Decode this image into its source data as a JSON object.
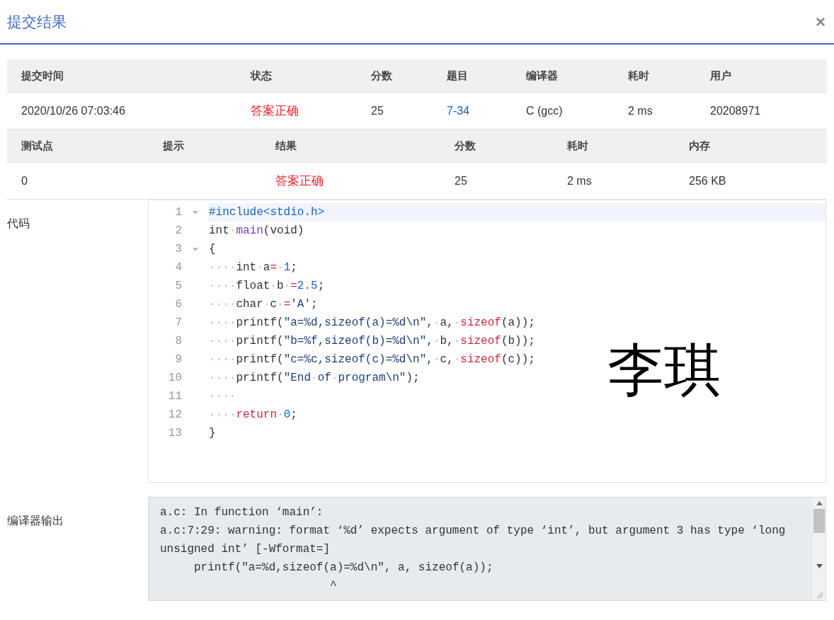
{
  "dialog": {
    "title": "提交结果",
    "close": "×"
  },
  "submission_table": {
    "columns": [
      "提交时间",
      "状态",
      "分数",
      "题目",
      "编译器",
      "耗时",
      "用户"
    ],
    "rows": [
      [
        {
          "text": "2020/10/26 07:03:46",
          "kind": "plain"
        },
        {
          "text": "答案正确",
          "kind": "status"
        },
        {
          "text": "25",
          "kind": "plain"
        },
        {
          "text": "7-34",
          "kind": "link"
        },
        {
          "text": "C (gcc)",
          "kind": "plain"
        },
        {
          "text": "2 ms",
          "kind": "plain"
        },
        {
          "text": "20208971",
          "kind": "plain"
        }
      ]
    ]
  },
  "testcase_table": {
    "columns": [
      "测试点",
      "提示",
      "结果",
      "分数",
      "耗时",
      "内存"
    ],
    "rows": [
      [
        {
          "text": "0",
          "kind": "plain"
        },
        {
          "kind": "empty"
        },
        {
          "text": "答案正确",
          "kind": "status"
        },
        {
          "text": "25",
          "kind": "plain"
        },
        {
          "text": "2 ms",
          "kind": "plain"
        },
        {
          "text": "256 KB",
          "kind": "plain"
        }
      ]
    ]
  },
  "code": {
    "label": "代码",
    "overlay_text": "李琪",
    "lines": [
      {
        "number": "1",
        "foldable": true,
        "active": true,
        "tokens": [
          {
            "text": "#include<stdio.h>",
            "kind": "pre"
          }
        ]
      },
      {
        "number": "2",
        "foldable": false,
        "active": false,
        "tokens": [
          {
            "text": "int",
            "kind": "plain"
          },
          {
            "text": "·",
            "kind": "ws"
          },
          {
            "text": "main",
            "kind": "fn"
          },
          {
            "text": "(void)",
            "kind": "plain"
          }
        ]
      },
      {
        "number": "3",
        "foldable": true,
        "active": false,
        "tokens": [
          {
            "text": "{",
            "kind": "plain"
          }
        ]
      },
      {
        "number": "4",
        "foldable": false,
        "active": false,
        "tokens": [
          {
            "text": "····",
            "kind": "ws"
          },
          {
            "text": "int",
            "kind": "plain"
          },
          {
            "text": "·",
            "kind": "ws"
          },
          {
            "text": "a",
            "kind": "plain"
          },
          {
            "text": "=",
            "kind": "op"
          },
          {
            "text": "·",
            "kind": "ws"
          },
          {
            "text": "1",
            "kind": "num"
          },
          {
            "text": ";",
            "kind": "plain"
          }
        ]
      },
      {
        "number": "5",
        "foldable": false,
        "active": false,
        "tokens": [
          {
            "text": "····",
            "kind": "ws"
          },
          {
            "text": "float",
            "kind": "plain"
          },
          {
            "text": "·",
            "kind": "ws"
          },
          {
            "text": "b",
            "kind": "plain"
          },
          {
            "text": "·",
            "kind": "ws"
          },
          {
            "text": "=",
            "kind": "op"
          },
          {
            "text": "2.5",
            "kind": "num"
          },
          {
            "text": ";",
            "kind": "plain"
          }
        ]
      },
      {
        "number": "6",
        "foldable": false,
        "active": false,
        "tokens": [
          {
            "text": "····",
            "kind": "ws"
          },
          {
            "text": "char",
            "kind": "plain"
          },
          {
            "text": "·",
            "kind": "ws"
          },
          {
            "text": "c",
            "kind": "plain"
          },
          {
            "text": "·",
            "kind": "ws"
          },
          {
            "text": "=",
            "kind": "op"
          },
          {
            "text": "'A'",
            "kind": "str"
          },
          {
            "text": ";",
            "kind": "plain"
          }
        ]
      },
      {
        "number": "7",
        "foldable": false,
        "active": false,
        "tokens": [
          {
            "text": "····",
            "kind": "ws"
          },
          {
            "text": "printf(",
            "kind": "plain"
          },
          {
            "text": "\"a=%d,sizeof(a)=%d\\n\"",
            "kind": "str"
          },
          {
            "text": ",",
            "kind": "plain"
          },
          {
            "text": "·",
            "kind": "ws"
          },
          {
            "text": "a,",
            "kind": "plain"
          },
          {
            "text": "·",
            "kind": "ws"
          },
          {
            "text": "sizeof",
            "kind": "kw"
          },
          {
            "text": "(a));",
            "kind": "plain"
          }
        ]
      },
      {
        "number": "8",
        "foldable": false,
        "active": false,
        "tokens": [
          {
            "text": "····",
            "kind": "ws"
          },
          {
            "text": "printf(",
            "kind": "plain"
          },
          {
            "text": "\"b=%f,sizeof(b)=%d\\n\"",
            "kind": "str"
          },
          {
            "text": ",",
            "kind": "plain"
          },
          {
            "text": "·",
            "kind": "ws"
          },
          {
            "text": "b,",
            "kind": "plain"
          },
          {
            "text": "·",
            "kind": "ws"
          },
          {
            "text": "sizeof",
            "kind": "kw"
          },
          {
            "text": "(b));",
            "kind": "plain"
          }
        ]
      },
      {
        "number": "9",
        "foldable": false,
        "active": false,
        "tokens": [
          {
            "text": "····",
            "kind": "ws"
          },
          {
            "text": "printf(",
            "kind": "plain"
          },
          {
            "text": "\"c=%c,sizeof(c)=%d\\n\"",
            "kind": "str"
          },
          {
            "text": ",",
            "kind": "plain"
          },
          {
            "text": "·",
            "kind": "ws"
          },
          {
            "text": "c,",
            "kind": "plain"
          },
          {
            "text": "·",
            "kind": "ws"
          },
          {
            "text": "sizeof",
            "kind": "kw"
          },
          {
            "text": "(c));",
            "kind": "plain"
          }
        ]
      },
      {
        "number": "10",
        "foldable": false,
        "active": false,
        "tokens": [
          {
            "text": "····",
            "kind": "ws"
          },
          {
            "text": "printf(",
            "kind": "plain"
          },
          {
            "text": "\"End",
            "kind": "str"
          },
          {
            "text": "·",
            "kind": "ws"
          },
          {
            "text": "of",
            "kind": "str"
          },
          {
            "text": "·",
            "kind": "ws"
          },
          {
            "text": "program\\n\"",
            "kind": "str"
          },
          {
            "text": ");",
            "kind": "plain"
          }
        ]
      },
      {
        "number": "11",
        "foldable": false,
        "active": false,
        "tokens": [
          {
            "text": "····",
            "kind": "ws"
          }
        ]
      },
      {
        "number": "12",
        "foldable": false,
        "active": false,
        "tokens": [
          {
            "text": "····",
            "kind": "ws"
          },
          {
            "text": "return",
            "kind": "kw"
          },
          {
            "text": "·",
            "kind": "ws"
          },
          {
            "text": "0",
            "kind": "num"
          },
          {
            "text": ";",
            "kind": "plain"
          }
        ]
      },
      {
        "number": "13",
        "foldable": false,
        "active": false,
        "tokens": [
          {
            "text": "}",
            "kind": "plain"
          }
        ]
      }
    ]
  },
  "compiler_output": {
    "label": "编译器输出",
    "lines": [
      "a.c: In function ‘main’:",
      "a.c:7:29: warning: format ‘%d’ expects argument of type ‘int’, but argument 3 has type ‘long unsigned int’ [-Wformat=]",
      "     printf(\"a=%d,sizeof(a)=%d\\n\", a, sizeof(a));",
      "                         ^"
    ]
  }
}
